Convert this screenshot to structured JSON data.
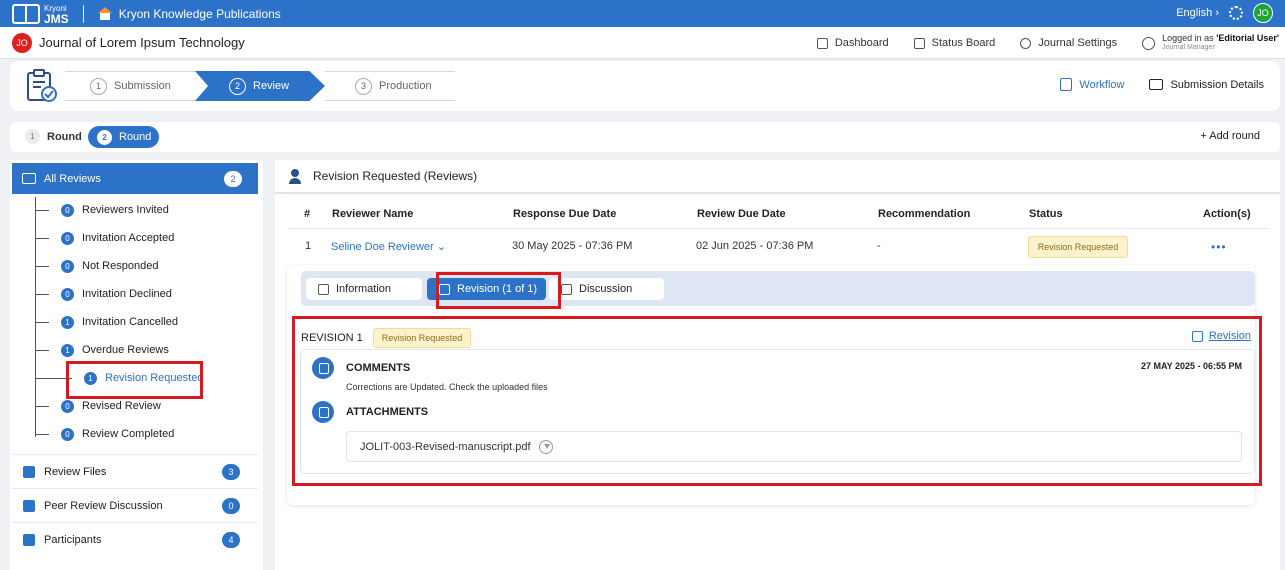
{
  "topbar": {
    "logo_small": "Kryoni",
    "logo_big": "JMS",
    "publication": "Kryon Knowledge Publications",
    "language": "English",
    "avatar": "JO"
  },
  "journalbar": {
    "badge": "JO",
    "title": "Journal of Lorem Ipsum Technology",
    "nav": [
      "Dashboard",
      "Status Board",
      "Journal Settings"
    ],
    "login_prefix": "Logged in as ",
    "login_role": "'Editorial User'",
    "login_sub": "Journal Manager"
  },
  "workflow": {
    "steps": [
      {
        "num": "1",
        "label": "Submission"
      },
      {
        "num": "2",
        "label": "Review"
      },
      {
        "num": "3",
        "label": "Production"
      }
    ],
    "workflow_link": "Workflow",
    "submission_details": "Submission Details"
  },
  "rounds": {
    "r1_num": "1",
    "r1_label": "Round",
    "r2_num": "2",
    "r2_label": "Round",
    "add_round": "+ Add round"
  },
  "sidebar": {
    "all_reviews": "All Reviews",
    "all_reviews_count": "2",
    "tree": [
      {
        "count": "0",
        "label": "Reviewers Invited"
      },
      {
        "count": "0",
        "label": "Invitation Accepted"
      },
      {
        "count": "0",
        "label": "Not Responded"
      },
      {
        "count": "0",
        "label": "Invitation Declined"
      },
      {
        "count": "1",
        "label": "Invitation Cancelled"
      },
      {
        "count": "1",
        "label": "Overdue Reviews"
      },
      {
        "count": "1",
        "label": "Revision Requested"
      },
      {
        "count": "0",
        "label": "Revised Review"
      },
      {
        "count": "0",
        "label": "Review Completed"
      }
    ],
    "sections": [
      {
        "label": "Review Files",
        "count": "3"
      },
      {
        "label": "Peer Review Discussion",
        "count": "0"
      },
      {
        "label": "Participants",
        "count": "4"
      }
    ]
  },
  "main": {
    "title": "Revision Requested (Reviews)",
    "columns": [
      "#",
      "Reviewer Name",
      "Response Due Date",
      "Review Due Date",
      "Recommendation",
      "Status",
      "Action(s)"
    ],
    "row": {
      "index": "1",
      "reviewer": "Seline Doe Reviewer",
      "response_due": "30 May 2025 - 07:36 PM",
      "review_due": "02 Jun 2025 - 07:36 PM",
      "recommendation": "-",
      "status": "Revision Requested",
      "actions": "•••"
    },
    "tabs": [
      "Information",
      "Revision (1 of 1)",
      "Discussion"
    ],
    "revision": {
      "heading": "REVISION 1",
      "badge": "Revision Requested",
      "link": "Revision",
      "comments_title": "COMMENTS",
      "comment": "Corrections are  Updated. Check the uploaded files",
      "comment_date": "27 MAY 2025 - 06:55 PM",
      "attachments_title": "ATTACHMENTS",
      "file": "JOLIT-003-Revised-manuscript.pdf"
    }
  },
  "colors": {
    "primary": "#2c72c9",
    "highlight": "#d71920",
    "badge_bg": "#fdf2cc"
  }
}
